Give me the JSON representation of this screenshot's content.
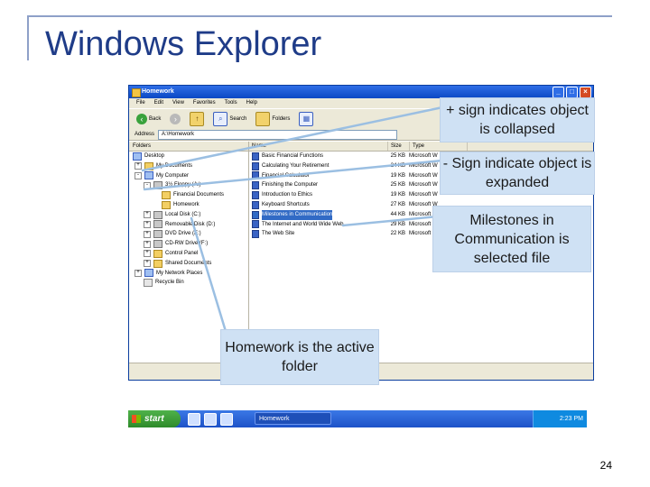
{
  "slide": {
    "title": "Windows Explorer",
    "page_number": "24"
  },
  "window": {
    "title": "Homework",
    "menu": [
      "File",
      "Edit",
      "View",
      "Favorites",
      "Tools",
      "Help"
    ],
    "toolbar": {
      "back": "Back",
      "search": "Search",
      "folders": "Folders"
    },
    "address_label": "Address",
    "address_value": "A:\\Homework",
    "folders_pane_label": "Folders",
    "tree": [
      {
        "label": "Desktop",
        "expander": "",
        "icon": "desktop-icon"
      },
      {
        "label": "My Documents",
        "expander": "+",
        "icon": "folder-icon"
      },
      {
        "label": "My Computer",
        "expander": "-",
        "icon": "computer-icon"
      },
      {
        "label": "3½ Floppy (A:)",
        "expander": "-",
        "icon": "floppy-icon"
      },
      {
        "label": "Financial Documents",
        "expander": "",
        "icon": "folder-icon"
      },
      {
        "label": "Homework",
        "expander": "",
        "icon": "folder-icon"
      },
      {
        "label": "Local Disk (C:)",
        "expander": "+",
        "icon": "drive-icon"
      },
      {
        "label": "Removable Disk (D:)",
        "expander": "+",
        "icon": "drive-icon"
      },
      {
        "label": "DVD Drive (E:)",
        "expander": "+",
        "icon": "drive-icon"
      },
      {
        "label": "CD-RW Drive (F:)",
        "expander": "+",
        "icon": "drive-icon"
      },
      {
        "label": "Control Panel",
        "expander": "+",
        "icon": "folder-icon"
      },
      {
        "label": "Shared Documents",
        "expander": "+",
        "icon": "folder-icon"
      },
      {
        "label": "My Network Places",
        "expander": "+",
        "icon": "network-icon"
      },
      {
        "label": "Recycle Bin",
        "expander": "",
        "icon": "recycle-bin-icon"
      }
    ],
    "columns": [
      "Name",
      "Size",
      "Type"
    ],
    "files": [
      {
        "name": "Basic Financial Functions",
        "size": "25 KB",
        "type": "Microsoft W"
      },
      {
        "name": "Calculating Your Retirement",
        "size": "24 KB",
        "type": "Microsoft W"
      },
      {
        "name": "Financial Calculator",
        "size": "19 KB",
        "type": "Microsoft W"
      },
      {
        "name": "Finishing the Computer",
        "size": "25 KB",
        "type": "Microsoft W"
      },
      {
        "name": "Introduction to Ethics",
        "size": "19 KB",
        "type": "Microsoft W"
      },
      {
        "name": "Keyboard Shortcuts",
        "size": "27 KB",
        "type": "Microsoft W"
      },
      {
        "name": "Milestones in Communication",
        "size": "44 KB",
        "type": "Microsoft W",
        "selected": true
      },
      {
        "name": "The Internet and World Wide Web",
        "size": "29 KB",
        "type": "Microsoft W"
      },
      {
        "name": "The Web Site",
        "size": "22 KB",
        "type": "Microsoft W"
      }
    ]
  },
  "taskbar": {
    "start": "start",
    "task": "Homework",
    "clock": "2:23 PM"
  },
  "callouts": {
    "plus": "+ sign indicates object is collapsed",
    "minus": "- Sign indicate object is expanded",
    "selected": "Milestones in Communication is selected file",
    "active": "Homework is the active folder"
  },
  "colors": {
    "title": "#1f3c88",
    "callout_bg": "#cfe1f4",
    "leader": "#9bbfe2",
    "xp_blue": "#0a48c4"
  }
}
